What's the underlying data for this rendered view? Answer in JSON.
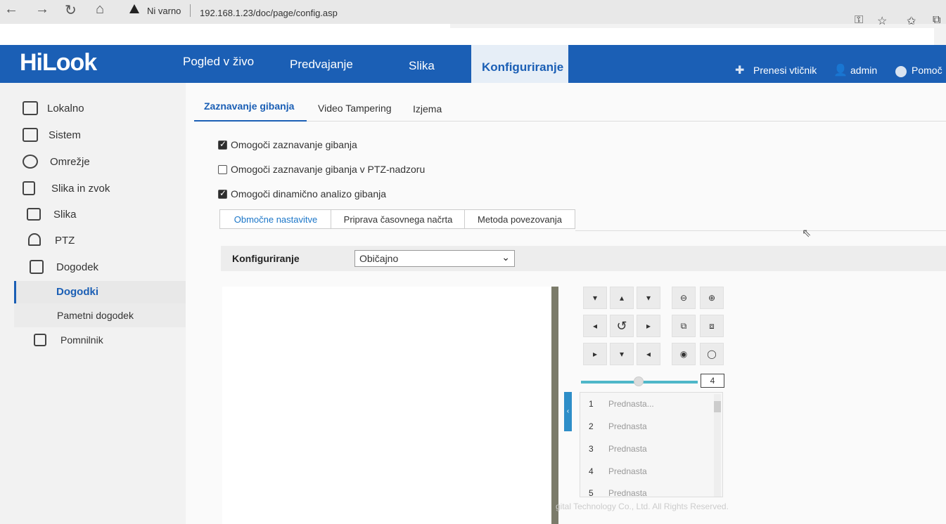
{
  "browser": {
    "nav_back": "←",
    "nav_forward": "→",
    "nav_reload": "↻",
    "nav_home": "⌂",
    "security_label": "Ni varno",
    "url": "192.168.1.23/doc/page/config.asp"
  },
  "header": {
    "logo": "HiLook",
    "tabs": [
      {
        "label": "Pogled v živo"
      },
      {
        "label": "Predvajanje"
      },
      {
        "label": "Slika"
      },
      {
        "label": "Konfiguriranje"
      }
    ],
    "plugin_label": "Prenesi vtičnik",
    "user_label": "admin",
    "help_label": "Pomoč"
  },
  "sidebar": {
    "items": [
      {
        "label": "Lokalno",
        "icon": "monitor-icon"
      },
      {
        "label": "Sistem",
        "icon": "system-icon"
      },
      {
        "label": "Omrežje",
        "icon": "globe-icon"
      },
      {
        "label": "Slika in zvok",
        "icon": "video-audio-icon"
      },
      {
        "label": "Slika",
        "icon": "image-icon"
      },
      {
        "label": "PTZ",
        "icon": "ptz-icon"
      },
      {
        "label": "Dogodek",
        "icon": "calendar-icon"
      }
    ],
    "sub_items": [
      {
        "label": "Dogodki"
      },
      {
        "label": "Pametni dogodek"
      }
    ],
    "storage": {
      "label": "Pomnilnik",
      "icon": "storage-icon"
    }
  },
  "content": {
    "subtabs": [
      {
        "label": "Zaznavanje gibanja"
      },
      {
        "label": "Video Tampering"
      },
      {
        "label": "Izjema"
      }
    ],
    "checkboxes": [
      {
        "label": "Omogoči zaznavanje gibanja",
        "checked": true
      },
      {
        "label": "Omogoči zaznavanje gibanja v PTZ-nadzoru",
        "checked": false
      },
      {
        "label": "Omogoči dinamično analizo gibanja",
        "checked": true
      }
    ],
    "steps": [
      {
        "label": "Območne nastavitve"
      },
      {
        "label": "Priprava časovnega načrta"
      },
      {
        "label": "Metoda povezovanja"
      }
    ],
    "config_label": "Konfiguriranje",
    "config_value": "Običajno",
    "speed_value": "4",
    "presets": [
      {
        "num": "1",
        "name": "Prednasta..."
      },
      {
        "num": "2",
        "name": "Prednasta"
      },
      {
        "num": "3",
        "name": "Prednasta"
      },
      {
        "num": "4",
        "name": "Prednasta"
      },
      {
        "num": "5",
        "name": "Prednasta"
      }
    ],
    "footer": "gital Technology Co., Ltd. All Rights Reserved."
  }
}
